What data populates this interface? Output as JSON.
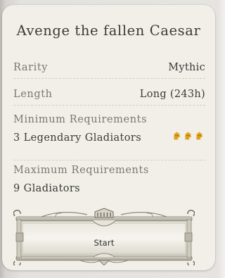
{
  "card": {
    "title": "Avenge the fallen Caesar",
    "rarity": {
      "label": "Rarity",
      "value": "Mythic"
    },
    "length": {
      "label": "Length",
      "value": "Long (243h)"
    },
    "minimum": {
      "label": "Minimum Requirements",
      "value": "3 Legendary Gladiators",
      "icon": "gladiator-helmet-icon",
      "icon_count": 3,
      "icon_color": "#e0a11b"
    },
    "maximum": {
      "label": "Maximum Requirements",
      "value": "9 Gladiators"
    },
    "start_label": "Start"
  }
}
